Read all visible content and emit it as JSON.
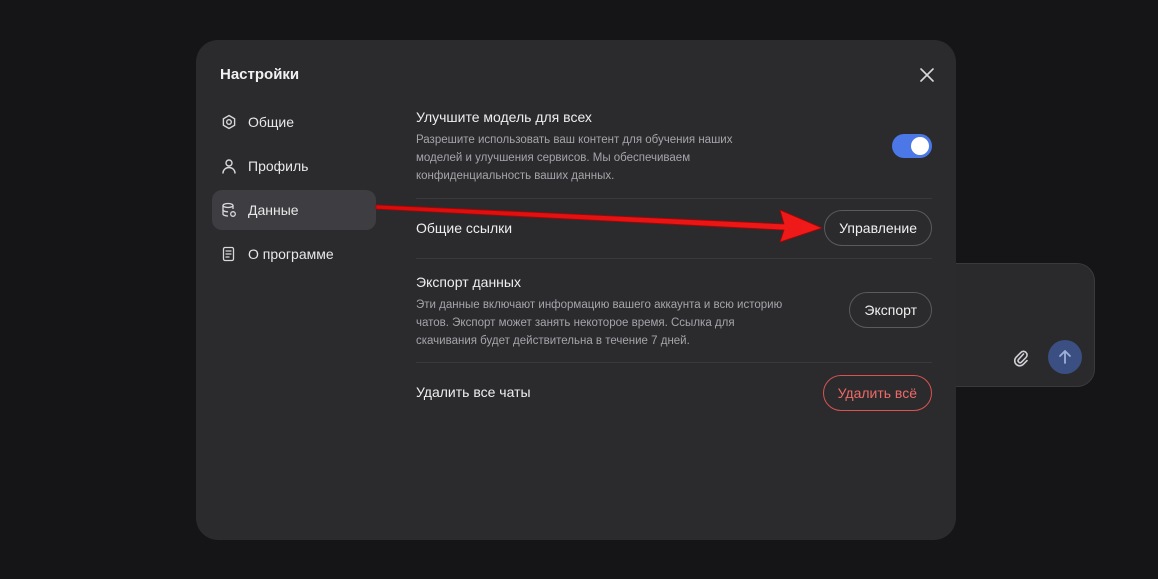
{
  "dialog": {
    "title": "Настройки"
  },
  "sidebar": {
    "items": [
      {
        "label": "Общие",
        "icon": "gear-icon",
        "active": false
      },
      {
        "label": "Профиль",
        "icon": "user-icon",
        "active": false
      },
      {
        "label": "Данные",
        "icon": "database-icon",
        "active": true
      },
      {
        "label": "О программе",
        "icon": "document-icon",
        "active": false
      }
    ]
  },
  "settings": {
    "improve": {
      "title": "Улучшите модель для всех",
      "description": "Разрешите использовать ваш контент для обучения наших моделей и улучшения сервисов. Мы обеспечиваем конфиденциальность ваших данных.",
      "enabled": true
    },
    "shared_links": {
      "title": "Общие ссылки",
      "button_label": "Управление"
    },
    "export": {
      "title": "Экспорт данных",
      "description": "Эти данные включают информацию вашего аккаунта и всю историю чатов. Экспорт может занять некоторое время. Ссылка для скачивания будет действительна в течение 7 дней.",
      "button_label": "Экспорт"
    },
    "delete_all": {
      "title": "Удалить все чаты",
      "button_label": "Удалить всё"
    }
  },
  "colors": {
    "accent": "#4b78e6",
    "danger": "#ef6a66",
    "annotation_arrow": "#e01010"
  }
}
